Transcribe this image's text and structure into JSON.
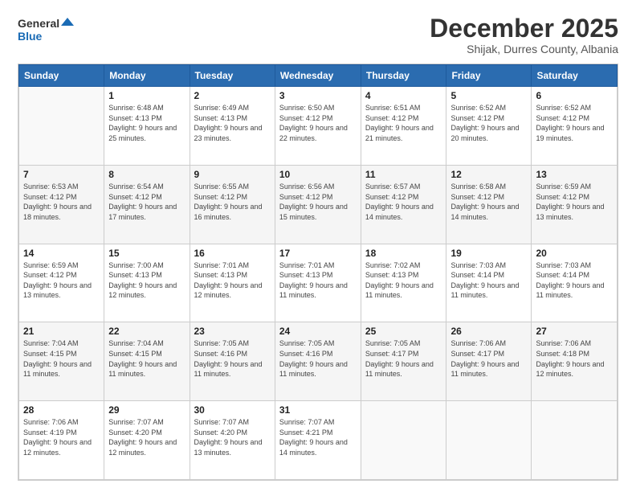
{
  "logo": {
    "line1": "General",
    "line2": "Blue"
  },
  "header": {
    "month": "December 2025",
    "location": "Shijak, Durres County, Albania"
  },
  "days": [
    "Sunday",
    "Monday",
    "Tuesday",
    "Wednesday",
    "Thursday",
    "Friday",
    "Saturday"
  ],
  "weeks": [
    [
      {
        "num": "",
        "sunrise": "",
        "sunset": "",
        "daylight": ""
      },
      {
        "num": "1",
        "sunrise": "6:48 AM",
        "sunset": "4:13 PM",
        "daylight": "9 hours and 25 minutes."
      },
      {
        "num": "2",
        "sunrise": "6:49 AM",
        "sunset": "4:13 PM",
        "daylight": "9 hours and 23 minutes."
      },
      {
        "num": "3",
        "sunrise": "6:50 AM",
        "sunset": "4:12 PM",
        "daylight": "9 hours and 22 minutes."
      },
      {
        "num": "4",
        "sunrise": "6:51 AM",
        "sunset": "4:12 PM",
        "daylight": "9 hours and 21 minutes."
      },
      {
        "num": "5",
        "sunrise": "6:52 AM",
        "sunset": "4:12 PM",
        "daylight": "9 hours and 20 minutes."
      },
      {
        "num": "6",
        "sunrise": "6:52 AM",
        "sunset": "4:12 PM",
        "daylight": "9 hours and 19 minutes."
      }
    ],
    [
      {
        "num": "7",
        "sunrise": "6:53 AM",
        "sunset": "4:12 PM",
        "daylight": "9 hours and 18 minutes."
      },
      {
        "num": "8",
        "sunrise": "6:54 AM",
        "sunset": "4:12 PM",
        "daylight": "9 hours and 17 minutes."
      },
      {
        "num": "9",
        "sunrise": "6:55 AM",
        "sunset": "4:12 PM",
        "daylight": "9 hours and 16 minutes."
      },
      {
        "num": "10",
        "sunrise": "6:56 AM",
        "sunset": "4:12 PM",
        "daylight": "9 hours and 15 minutes."
      },
      {
        "num": "11",
        "sunrise": "6:57 AM",
        "sunset": "4:12 PM",
        "daylight": "9 hours and 14 minutes."
      },
      {
        "num": "12",
        "sunrise": "6:58 AM",
        "sunset": "4:12 PM",
        "daylight": "9 hours and 14 minutes."
      },
      {
        "num": "13",
        "sunrise": "6:59 AM",
        "sunset": "4:12 PM",
        "daylight": "9 hours and 13 minutes."
      }
    ],
    [
      {
        "num": "14",
        "sunrise": "6:59 AM",
        "sunset": "4:12 PM",
        "daylight": "9 hours and 13 minutes."
      },
      {
        "num": "15",
        "sunrise": "7:00 AM",
        "sunset": "4:13 PM",
        "daylight": "9 hours and 12 minutes."
      },
      {
        "num": "16",
        "sunrise": "7:01 AM",
        "sunset": "4:13 PM",
        "daylight": "9 hours and 12 minutes."
      },
      {
        "num": "17",
        "sunrise": "7:01 AM",
        "sunset": "4:13 PM",
        "daylight": "9 hours and 11 minutes."
      },
      {
        "num": "18",
        "sunrise": "7:02 AM",
        "sunset": "4:13 PM",
        "daylight": "9 hours and 11 minutes."
      },
      {
        "num": "19",
        "sunrise": "7:03 AM",
        "sunset": "4:14 PM",
        "daylight": "9 hours and 11 minutes."
      },
      {
        "num": "20",
        "sunrise": "7:03 AM",
        "sunset": "4:14 PM",
        "daylight": "9 hours and 11 minutes."
      }
    ],
    [
      {
        "num": "21",
        "sunrise": "7:04 AM",
        "sunset": "4:15 PM",
        "daylight": "9 hours and 11 minutes."
      },
      {
        "num": "22",
        "sunrise": "7:04 AM",
        "sunset": "4:15 PM",
        "daylight": "9 hours and 11 minutes."
      },
      {
        "num": "23",
        "sunrise": "7:05 AM",
        "sunset": "4:16 PM",
        "daylight": "9 hours and 11 minutes."
      },
      {
        "num": "24",
        "sunrise": "7:05 AM",
        "sunset": "4:16 PM",
        "daylight": "9 hours and 11 minutes."
      },
      {
        "num": "25",
        "sunrise": "7:05 AM",
        "sunset": "4:17 PM",
        "daylight": "9 hours and 11 minutes."
      },
      {
        "num": "26",
        "sunrise": "7:06 AM",
        "sunset": "4:17 PM",
        "daylight": "9 hours and 11 minutes."
      },
      {
        "num": "27",
        "sunrise": "7:06 AM",
        "sunset": "4:18 PM",
        "daylight": "9 hours and 12 minutes."
      }
    ],
    [
      {
        "num": "28",
        "sunrise": "7:06 AM",
        "sunset": "4:19 PM",
        "daylight": "9 hours and 12 minutes."
      },
      {
        "num": "29",
        "sunrise": "7:07 AM",
        "sunset": "4:20 PM",
        "daylight": "9 hours and 12 minutes."
      },
      {
        "num": "30",
        "sunrise": "7:07 AM",
        "sunset": "4:20 PM",
        "daylight": "9 hours and 13 minutes."
      },
      {
        "num": "31",
        "sunrise": "7:07 AM",
        "sunset": "4:21 PM",
        "daylight": "9 hours and 14 minutes."
      },
      {
        "num": "",
        "sunrise": "",
        "sunset": "",
        "daylight": ""
      },
      {
        "num": "",
        "sunrise": "",
        "sunset": "",
        "daylight": ""
      },
      {
        "num": "",
        "sunrise": "",
        "sunset": "",
        "daylight": ""
      }
    ]
  ],
  "labels": {
    "sunrise_prefix": "Sunrise: ",
    "sunset_prefix": "Sunset: ",
    "daylight_prefix": "Daylight: "
  }
}
